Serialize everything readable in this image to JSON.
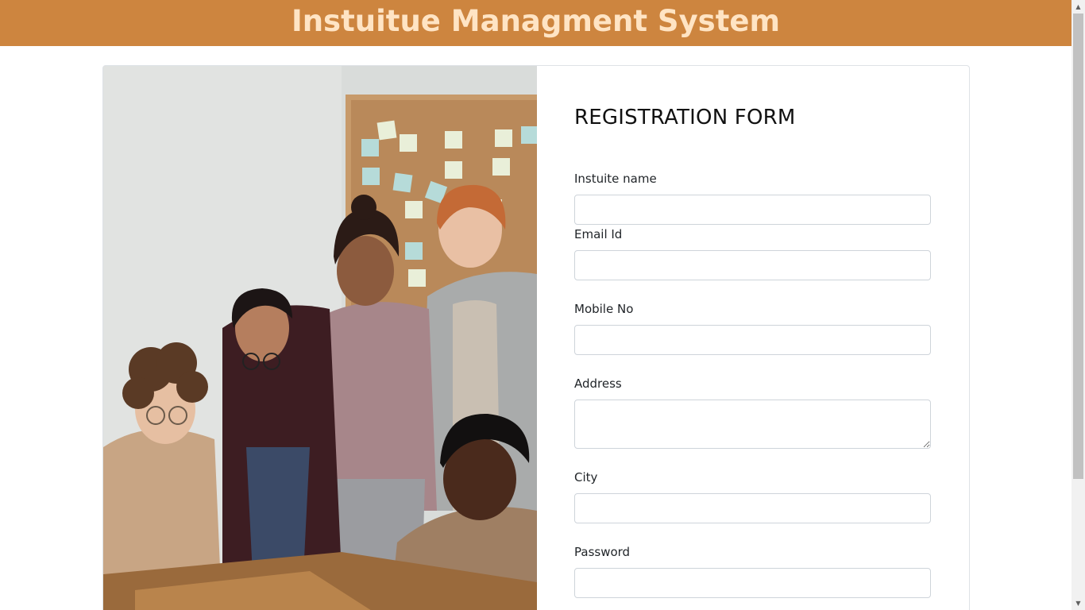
{
  "header": {
    "title": "Instuitue Managment System"
  },
  "hero_image": {
    "alt": "photo"
  },
  "form": {
    "title": "REGISTRATION FORM",
    "fields": {
      "institute_name": {
        "label": "Instuite name",
        "value": "",
        "placeholder": ""
      },
      "email": {
        "label": "Email Id",
        "value": "",
        "placeholder": ""
      },
      "mobile": {
        "label": "Mobile No",
        "value": "",
        "placeholder": ""
      },
      "address": {
        "label": "Address",
        "value": "",
        "placeholder": ""
      },
      "city": {
        "label": "City",
        "value": "",
        "placeholder": ""
      },
      "password": {
        "label": "Password",
        "value": "",
        "placeholder": ""
      }
    }
  },
  "scrollbar": {
    "up_icon": "triangle-up-icon",
    "down_icon": "triangle-down-icon"
  },
  "colors": {
    "header_bg": "#cd853f",
    "header_text": "#ffe4c4"
  }
}
